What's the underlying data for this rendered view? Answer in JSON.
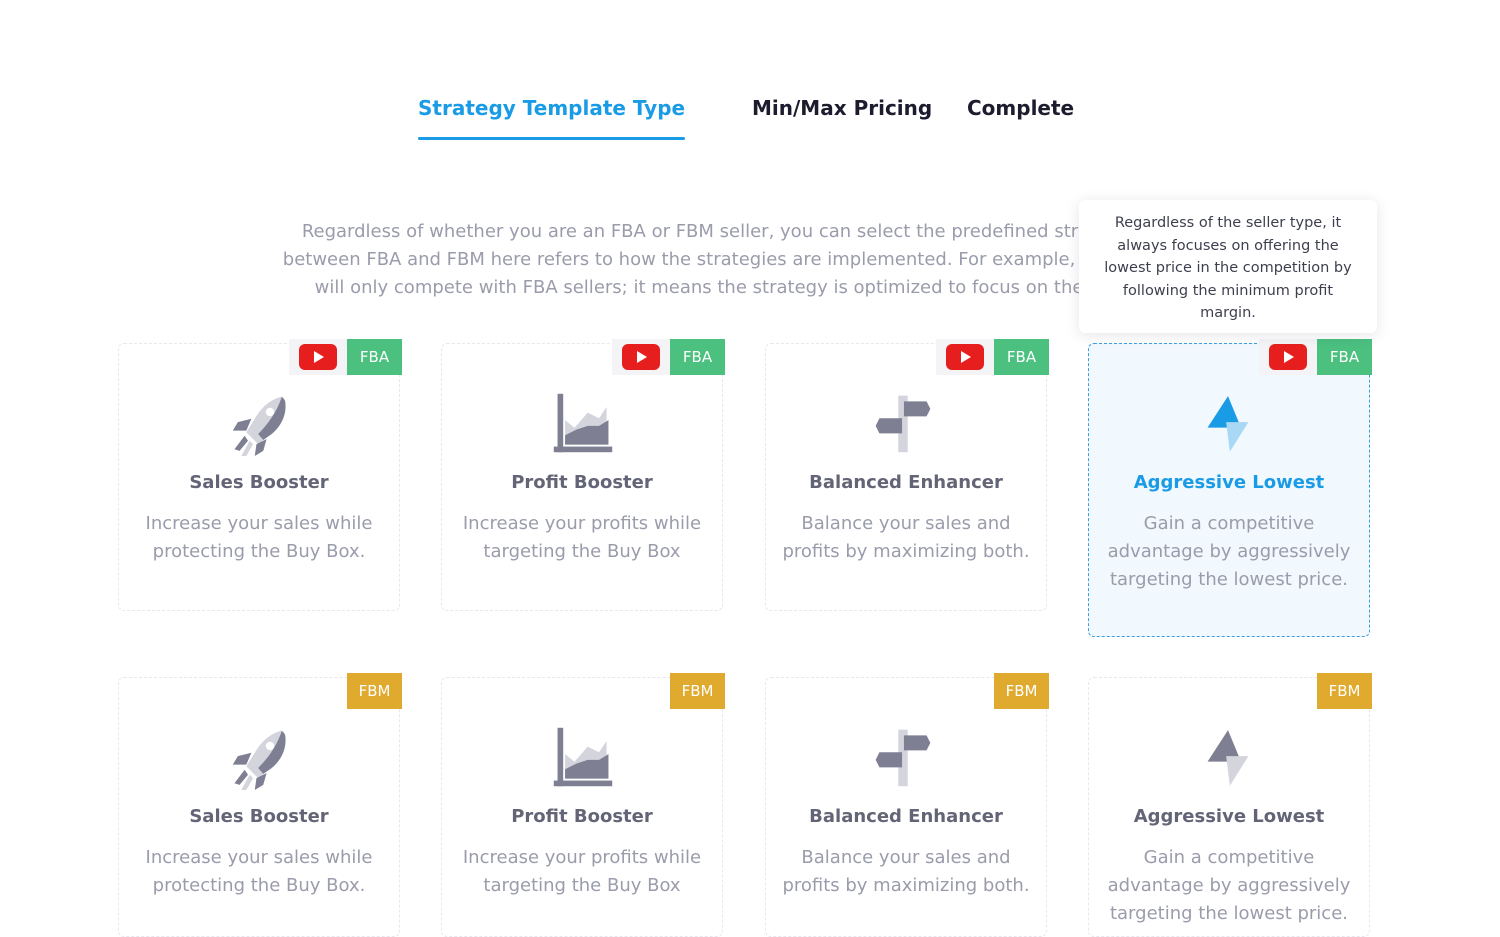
{
  "tabs": [
    {
      "label": "Strategy Template Type",
      "active": true
    },
    {
      "label": "Min/Max Pricing",
      "active": false
    },
    {
      "label": "Complete",
      "active": false
    }
  ],
  "intro": {
    "line1": "Regardless of whether you are an FBA or FBM seller, you can select the predefined strategy that su",
    "line2": "between FBA and FBM here refers to how the strategies are implemented. For example, choosing an FE",
    "line3": "will only compete with FBA sellers; it means the strategy is optimized to focus on the advantage"
  },
  "tooltip": {
    "text": "Regardless of the seller type, it always focuses on offering the lowest price in the competition by following the minimum profit margin."
  },
  "colors": {
    "accent": "#1a9be6",
    "fba_badge": "#4bc07f",
    "fbm_badge": "#dfaa2e",
    "youtube": "#e61e1e",
    "icon_gray": "#7e7f93",
    "icon_light": "#d4d5dc"
  },
  "cards_fba": [
    {
      "title": "Sales Booster",
      "desc": "Increase your sales while protecting the Buy Box.",
      "badge": "FBA",
      "icon": "rocket-icon"
    },
    {
      "title": "Profit Booster",
      "desc": "Increase your profits while targeting the Buy Box",
      "badge": "FBA",
      "icon": "area-chart-icon"
    },
    {
      "title": "Balanced Enhancer",
      "desc": "Balance your sales and profits by maximizing both.",
      "badge": "FBA",
      "icon": "signpost-icon"
    },
    {
      "title": "Aggressive Lowest",
      "desc": "Gain a competitive advantage by aggressively targeting the lowest price.",
      "badge": "FBA",
      "icon": "lightning-icon",
      "selected": true
    }
  ],
  "cards_fbm": [
    {
      "title": "Sales Booster",
      "desc": "Increase your sales while protecting the Buy Box.",
      "badge": "FBM",
      "icon": "rocket-icon"
    },
    {
      "title": "Profit Booster",
      "desc": "Increase your profits while targeting the Buy Box",
      "badge": "FBM",
      "icon": "area-chart-icon"
    },
    {
      "title": "Balanced Enhancer",
      "desc": "Balance your sales and profits by maximizing both.",
      "badge": "FBM",
      "icon": "signpost-icon"
    },
    {
      "title": "Aggressive Lowest",
      "desc": "Gain a competitive advantage by aggressively targeting the lowest price.",
      "badge": "FBM",
      "icon": "lightning-icon"
    }
  ]
}
